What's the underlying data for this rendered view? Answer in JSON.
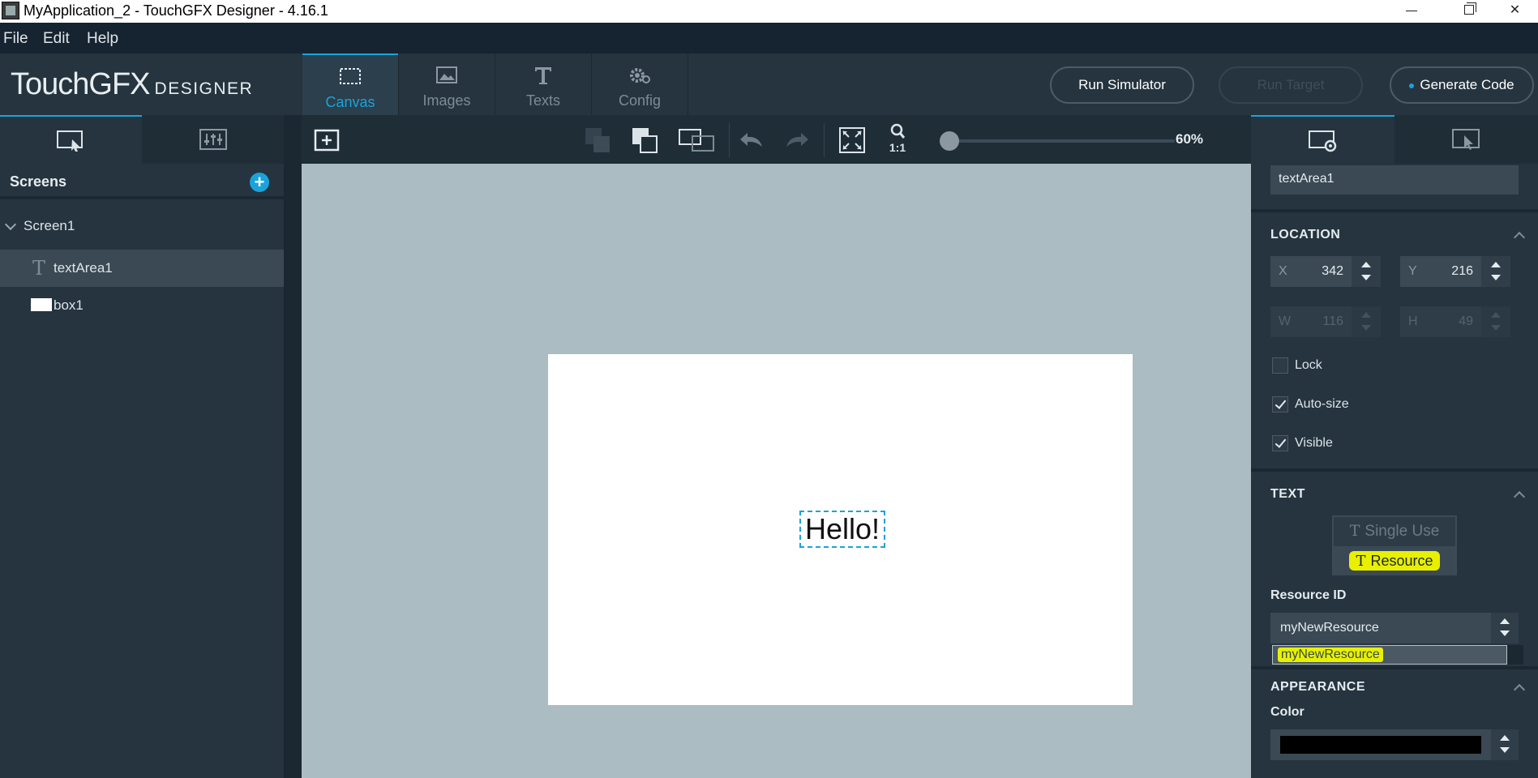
{
  "window": {
    "title": "MyApplication_2 - TouchGFX Designer - 4.16.1",
    "controls": {
      "minimize": "—",
      "close": "✕"
    }
  },
  "menu": {
    "items": [
      "File",
      "Edit",
      "Help"
    ]
  },
  "logo": {
    "main": "TouchGFX",
    "sub": "DESIGNER"
  },
  "main_tabs": [
    {
      "label": "Canvas",
      "icon": "canvas-icon",
      "active": true
    },
    {
      "label": "Images",
      "icon": "image-icon",
      "active": false
    },
    {
      "label": "Texts",
      "icon": "text-icon",
      "active": false
    },
    {
      "label": "Config",
      "icon": "gear-icon",
      "active": false
    }
  ],
  "toolbar_buttons": {
    "run_simulator": "Run Simulator",
    "run_target": "Run Target",
    "generate_code": "Generate Code"
  },
  "left_panel": {
    "screens_title": "Screens",
    "add_symbol": "+",
    "tree": {
      "screen": "Screen1",
      "widgets": [
        {
          "label": "textArea1",
          "icon": "text-widget-icon",
          "selected": true
        },
        {
          "label": "box1",
          "icon": "box-widget-icon",
          "selected": false
        }
      ]
    }
  },
  "canvas_toolbar": {
    "zoom_label": "60%",
    "zoom_value": 60,
    "one_to_one": "1:1"
  },
  "canvas": {
    "text_content": "Hello!"
  },
  "properties": {
    "name": "textArea1",
    "location": {
      "title": "LOCATION",
      "x_label": "X",
      "x": "342",
      "y_label": "Y",
      "y": "216",
      "w_label": "W",
      "w": "116",
      "h_label": "H",
      "h": "49"
    },
    "lock": {
      "label": "Lock",
      "checked": false
    },
    "auto_size": {
      "label": "Auto-size",
      "checked": true
    },
    "visible": {
      "label": "Visible",
      "checked": true
    },
    "text": {
      "title": "TEXT",
      "single_use": "Single Use",
      "resource": "Resource",
      "resource_id_label": "Resource ID",
      "resource_id_value": "myNewResource",
      "dropdown_item": "myNewResource"
    },
    "appearance": {
      "title": "APPEARANCE",
      "color_label": "Color",
      "color_value": "#000000"
    }
  },
  "colors": {
    "accent": "#1aa3da",
    "highlight": "#e8f000",
    "panel": "#25343f",
    "canvas_bg": "#abbcc2"
  }
}
